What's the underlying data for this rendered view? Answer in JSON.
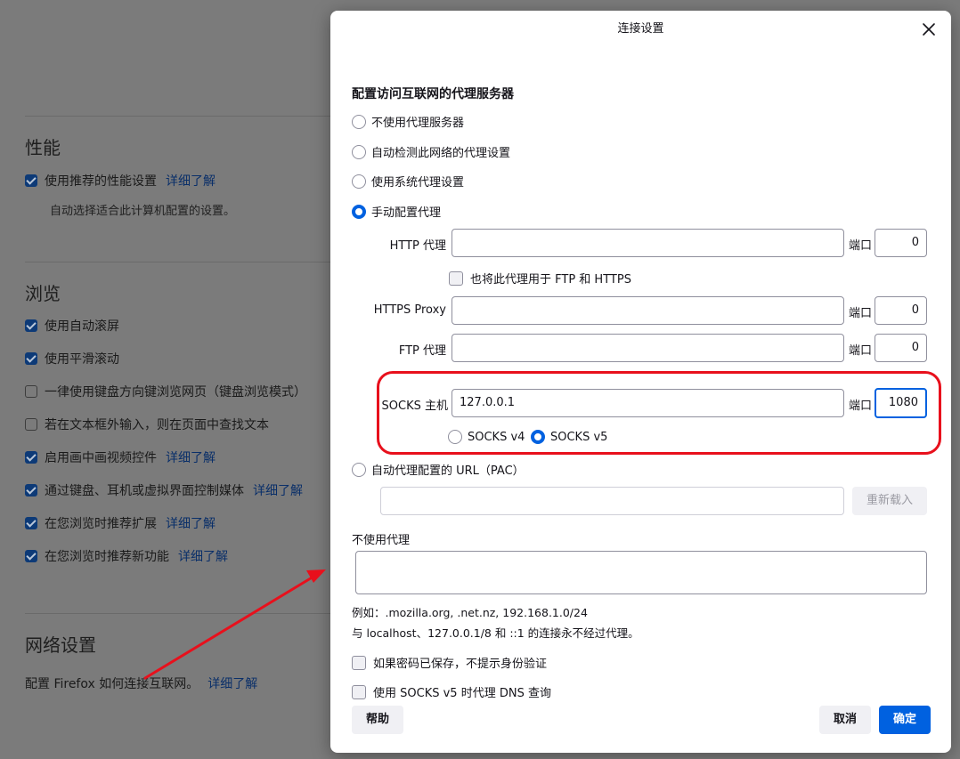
{
  "background": {
    "performance": {
      "title": "性能",
      "use_recommended": "使用推荐的性能设置",
      "learn_more": "详细了解",
      "desc": "自动选择适合此计算机配置的设置。"
    },
    "browsing": {
      "title": "浏览",
      "items": [
        {
          "label": "使用自动滚屏",
          "checked": true,
          "link": ""
        },
        {
          "label": "使用平滑滚动",
          "checked": true,
          "link": ""
        },
        {
          "label": "一律使用键盘方向键浏览网页（键盘浏览模式）",
          "checked": false,
          "link": ""
        },
        {
          "label": "若在文本框外输入，则在页面中查找文本",
          "checked": false,
          "link": ""
        },
        {
          "label": "启用画中画视频控件",
          "checked": true,
          "link": "详细了解"
        },
        {
          "label": "通过键盘、耳机或虚拟界面控制媒体",
          "checked": true,
          "link": "详细了解"
        },
        {
          "label": "在您浏览时推荐扩展",
          "checked": true,
          "link": "详细了解"
        },
        {
          "label": "在您浏览时推荐新功能",
          "checked": true,
          "link": "详细了解"
        }
      ]
    },
    "network": {
      "title": "网络设置",
      "desc": "配置 Firefox 如何连接互联网。",
      "learn_more": "详细了解"
    }
  },
  "dialog": {
    "title": "连接设置",
    "heading": "配置访问互联网的代理服务器",
    "proxy_options": {
      "none": "不使用代理服务器",
      "auto_detect": "自动检测此网络的代理设置",
      "system": "使用系统代理设置",
      "manual": "手动配置代理"
    },
    "selected_option": "manual",
    "http": {
      "label": "HTTP 代理",
      "host": "",
      "port_label": "端口",
      "port": "0"
    },
    "also_use": "也将此代理用于 FTP 和 HTTPS",
    "https": {
      "label": "HTTPS Proxy",
      "host": "",
      "port_label": "端口",
      "port": "0"
    },
    "ftp": {
      "label": "FTP 代理",
      "host": "",
      "port_label": "端口",
      "port": "0"
    },
    "socks": {
      "label": "SOCKS 主机",
      "host": "127.0.0.1",
      "port_label": "端口",
      "port": "1080",
      "v4": "SOCKS v4",
      "v5": "SOCKS v5",
      "selected": "v5"
    },
    "pac": {
      "label": "自动代理配置的 URL（PAC）",
      "url": "",
      "reload": "重新载入"
    },
    "no_proxy": {
      "label": "不使用代理",
      "value": "",
      "example": "例如：.mozilla.org, .net.nz, 192.168.1.0/24",
      "note": "与 localhost、127.0.0.1/8 和 ::1 的连接永不经过代理。"
    },
    "no_auth_prompt": "如果密码已保存，不提示身份验证",
    "socks_dns": "使用 SOCKS v5 时代理 DNS 查询",
    "buttons": {
      "help": "帮助",
      "cancel": "取消",
      "ok": "确定"
    }
  },
  "colors": {
    "accent": "#0061e0",
    "highlight": "#e8101c",
    "link": "#0a2f69"
  }
}
